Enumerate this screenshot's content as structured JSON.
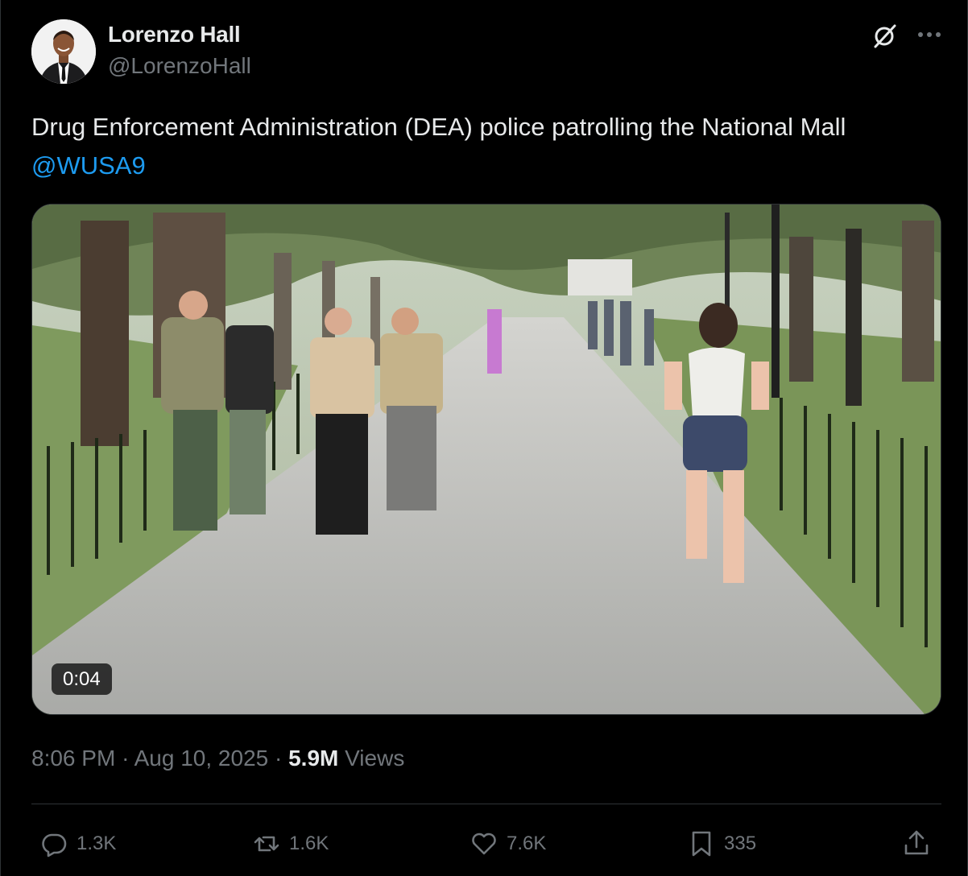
{
  "author": {
    "name": "Lorenzo Hall",
    "handle": "@LorenzoHall"
  },
  "tweet": {
    "text": "Drug Enforcement Administration (DEA) police patrolling the National Mall ",
    "mention": "@WUSA9"
  },
  "media": {
    "duration": "0:04"
  },
  "meta": {
    "time": "8:06 PM",
    "date": "Aug 10, 2025",
    "separator": "·",
    "views_count": "5.9M",
    "views_label": "Views"
  },
  "actions": {
    "replies": "1.3K",
    "reposts": "1.6K",
    "likes": "7.6K",
    "bookmarks": "335"
  },
  "icons": {
    "reply": "reply-icon",
    "repost": "repost-icon",
    "like": "heart-icon",
    "bookmark": "bookmark-icon",
    "share": "share-icon",
    "grok": "grok-icon",
    "more": "more-icon"
  },
  "colors": {
    "background": "#000000",
    "text": "#e7e9ea",
    "muted": "#71767b",
    "link": "#1d9bf0",
    "border": "#2f3336"
  }
}
